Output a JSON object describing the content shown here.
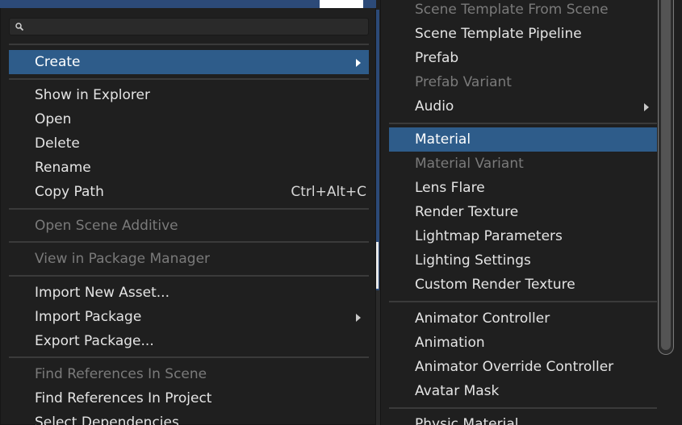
{
  "search": {
    "value": "",
    "placeholder": ""
  },
  "left_menu": {
    "create": "Create",
    "show_in_explorer": "Show in Explorer",
    "open": "Open",
    "delete": "Delete",
    "rename": "Rename",
    "copy_path": "Copy Path",
    "copy_path_shortcut": "Ctrl+Alt+C",
    "open_scene_additive": "Open Scene Additive",
    "view_in_package_manager": "View in Package Manager",
    "import_new_asset": "Import New Asset...",
    "import_package": "Import Package",
    "export_package": "Export Package...",
    "find_references_in_scene": "Find References In Scene",
    "find_references_in_project": "Find References In Project",
    "select_dependencies": "Select Dependencies"
  },
  "right_menu": {
    "scene_template_from_scene": "Scene Template From Scene",
    "scene_template_pipeline": "Scene Template Pipeline",
    "prefab": "Prefab",
    "prefab_variant": "Prefab Variant",
    "audio": "Audio",
    "material": "Material",
    "material_variant": "Material Variant",
    "lens_flare": "Lens Flare",
    "render_texture": "Render Texture",
    "lightmap_parameters": "Lightmap Parameters",
    "lighting_settings": "Lighting Settings",
    "custom_render_texture": "Custom Render Texture",
    "animator_controller": "Animator Controller",
    "animation": "Animation",
    "animator_override_controller": "Animator Override Controller",
    "avatar_mask": "Avatar Mask",
    "physic_material": "Physic Material"
  },
  "colors": {
    "highlight": "#2e5c8a",
    "menu_bg": "#1f1f1f",
    "text": "#e4e4e4",
    "disabled_text": "#7a7a7a"
  },
  "icons": {
    "search": "search-icon",
    "submenu": "chevron-right-icon"
  }
}
